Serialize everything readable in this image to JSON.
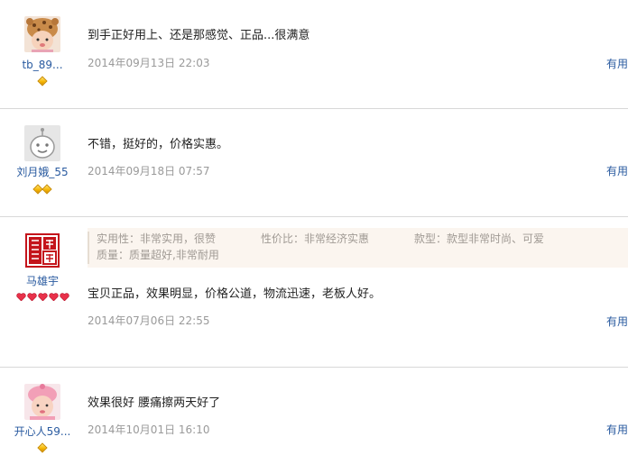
{
  "reviews": [
    {
      "user": "tb_89...",
      "avatar_icon": "baby-leopard-hat-avatar",
      "level_type": "diamond",
      "level_count": 1,
      "text": "到手正好用上、还是那感觉、正品...很满意",
      "date": "2014年09月13日 22:03",
      "useful_label": "有用"
    },
    {
      "user": "刘月娥_55",
      "avatar_icon": "default-robot-avatar",
      "level_type": "diamond",
      "level_count": 2,
      "text": "不错，挺好的，价格实惠。",
      "date": "2014年09月18日 07:57",
      "useful_label": "有用"
    },
    {
      "user": "马雄宇",
      "avatar_icon": "red-seal-avatar",
      "level_type": "heart",
      "level_count": 5,
      "tags": [
        "实用性：非常实用，很赞",
        "性价比：非常经济实惠",
        "款型：款型非常时尚、可爱",
        "质量：质量超好,非常耐用"
      ],
      "text": "宝贝正品，效果明显，价格公道，物流迅速，老板人好。",
      "date": "2014年07月06日 22:55",
      "useful_label": "有用"
    },
    {
      "user": "开心人59...",
      "avatar_icon": "baby-pink-hat-avatar",
      "level_type": "diamond",
      "level_count": 1,
      "text": "效果很好 腰痛擦两天好了",
      "date": "2014年10月01日 16:10",
      "useful_label": "有用"
    }
  ]
}
